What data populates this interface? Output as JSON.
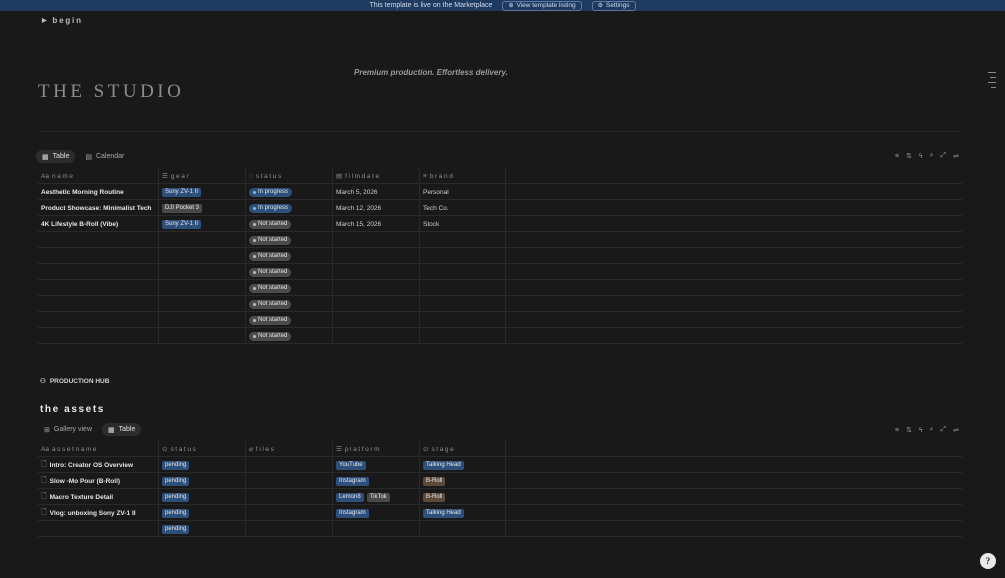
{
  "banner": {
    "text": "This template is live on the Marketplace",
    "view_listing": "View template listing",
    "settings": "Settings"
  },
  "toggle": {
    "label": "begin"
  },
  "tagline": "Premium production. Effortless delivery.",
  "title": "THE STUDIO",
  "productions": {
    "tabs": [
      {
        "label": "Table",
        "icon": "table-icon",
        "active": true
      },
      {
        "label": "Calendar",
        "icon": "calendar-icon",
        "active": false
      }
    ],
    "columns": [
      {
        "label": "name",
        "icon": "Aa"
      },
      {
        "label": "gear",
        "icon": "list-icon"
      },
      {
        "label": "status",
        "icon": "status-icon"
      },
      {
        "label": "filmdate",
        "icon": "calendar-icon"
      },
      {
        "label": "brand",
        "icon": "text-icon"
      }
    ],
    "rows": [
      {
        "name": "Aesthetic Morning Routine",
        "gear": "Sony ZV-1 II",
        "gear_color": "blue",
        "status": "In progress",
        "filmdate": "March 5, 2026",
        "brand": "Personal"
      },
      {
        "name": "Product Showcase: Minimalist Tech",
        "gear": "DJI Pocket 3",
        "gear_color": "gray",
        "status": "In progress",
        "filmdate": "March 12, 2026",
        "brand": "Tech Co."
      },
      {
        "name": "4K Lifestyle B-Roll (Vibe)",
        "gear": "Sony ZV-1 II",
        "gear_color": "blue",
        "status": "Not started",
        "filmdate": "March 15, 2026",
        "brand": "Stock"
      },
      {
        "name": "",
        "gear": "",
        "status": "Not started",
        "filmdate": "",
        "brand": ""
      },
      {
        "name": "",
        "gear": "",
        "status": "Not started",
        "filmdate": "",
        "brand": ""
      },
      {
        "name": "",
        "gear": "",
        "status": "Not started",
        "filmdate": "",
        "brand": ""
      },
      {
        "name": "",
        "gear": "",
        "status": "Not started",
        "filmdate": "",
        "brand": ""
      },
      {
        "name": "",
        "gear": "",
        "status": "Not started",
        "filmdate": "",
        "brand": ""
      },
      {
        "name": "",
        "gear": "",
        "status": "Not started",
        "filmdate": "",
        "brand": ""
      },
      {
        "name": "",
        "gear": "",
        "status": "Not started",
        "filmdate": "",
        "brand": ""
      }
    ]
  },
  "hub": {
    "label": "PRODUCTION HUB"
  },
  "assets": {
    "title": "the assets",
    "tabs": [
      {
        "label": "Gallery view",
        "icon": "gallery-icon",
        "active": false
      },
      {
        "label": "Table",
        "icon": "table-icon",
        "active": true
      }
    ],
    "columns": [
      {
        "label": "assetname",
        "icon": "Aa"
      },
      {
        "label": "status",
        "icon": "status-icon"
      },
      {
        "label": "files",
        "icon": "paperclip-icon"
      },
      {
        "label": "platform",
        "icon": "list-icon"
      },
      {
        "label": "stage",
        "icon": "stage-icon"
      }
    ],
    "rows": [
      {
        "name": "Intro: Creator OS Overview",
        "status": "pending",
        "files": "",
        "platform": [
          "YouTube"
        ],
        "stage": "Talking Head",
        "stage_color": "blue"
      },
      {
        "name": "Slow -Mo Pour (B-Roll)",
        "status": "pending",
        "files": "",
        "platform": [
          "Instagram"
        ],
        "stage": "B-Roll",
        "stage_color": "brown"
      },
      {
        "name": "Macro Texture Detail",
        "status": "pending",
        "files": "",
        "platform": [
          "Lemon8",
          "TikTok"
        ],
        "stage": "B-Roll",
        "stage_color": "brown"
      },
      {
        "name": "Vlog: unboxing Sony ZV-1 II",
        "status": "pending",
        "files": "",
        "platform": [
          "Instagram"
        ],
        "stage": "Talking Head",
        "stage_color": "blue"
      },
      {
        "name": "",
        "status": "pending",
        "files": "",
        "platform": [],
        "stage": ""
      }
    ]
  },
  "toolbar_icons": [
    "filter-icon",
    "sort-icon",
    "automation-icon",
    "search-icon",
    "expand-icon",
    "settings-icon"
  ],
  "help": {
    "label": "?"
  }
}
